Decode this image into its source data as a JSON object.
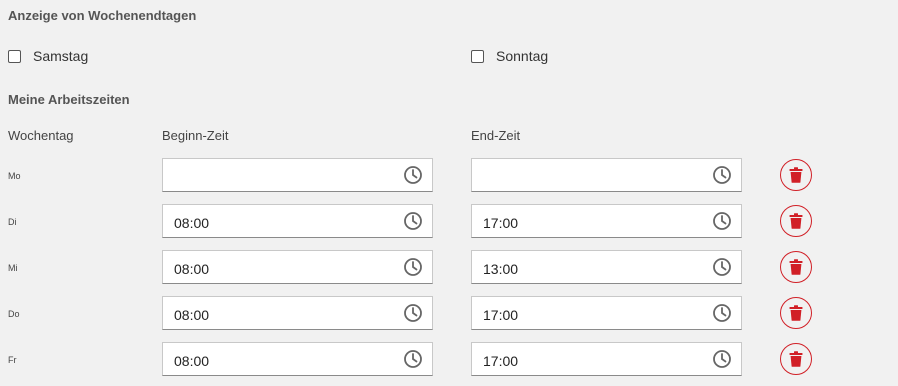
{
  "weekend": {
    "title": "Anzeige von Wochenendtagen",
    "saturday_label": "Samstag",
    "sunday_label": "Sonntag",
    "saturday_checked": false,
    "sunday_checked": false
  },
  "working_hours": {
    "title": "Meine Arbeitszeiten",
    "headers": {
      "day": "Wochentag",
      "start": "Beginn-Zeit",
      "end": "End-Zeit"
    },
    "rows": [
      {
        "day": "Mo",
        "start": "",
        "end": ""
      },
      {
        "day": "Di",
        "start": "08:00",
        "end": "17:00"
      },
      {
        "day": "Mi",
        "start": "08:00",
        "end": "13:00"
      },
      {
        "day": "Do",
        "start": "08:00",
        "end": "17:00"
      },
      {
        "day": "Fr",
        "start": "08:00",
        "end": "17:00"
      }
    ]
  },
  "icons": {
    "time_picker": "clock-icon",
    "delete": "trash-icon"
  },
  "colors": {
    "accent": "#d11f26",
    "icon_gray": "#666666",
    "background": "#f1f1f1"
  }
}
